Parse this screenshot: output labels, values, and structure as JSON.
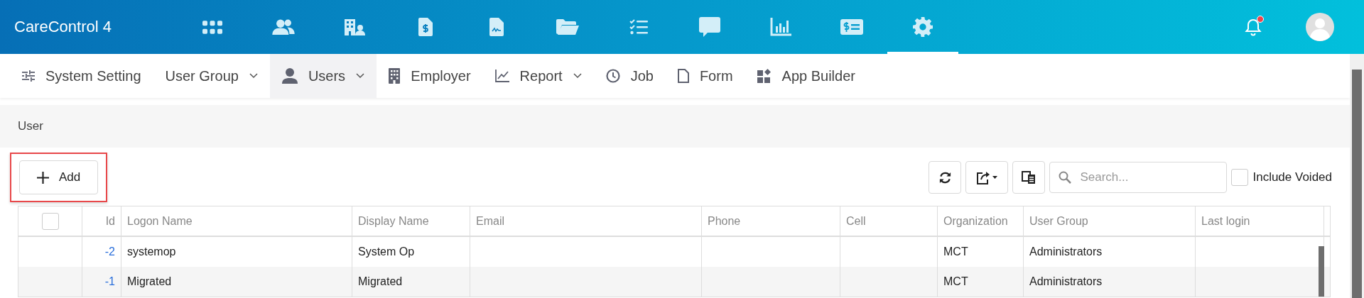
{
  "app": {
    "title": "CareControl 4"
  },
  "nav_icons": [
    {
      "selected": false
    },
    {
      "selected": false
    },
    {
      "selected": false
    },
    {
      "selected": false
    },
    {
      "selected": false
    },
    {
      "selected": false
    },
    {
      "selected": false
    },
    {
      "selected": false
    },
    {
      "selected": false
    },
    {
      "selected": false
    },
    {
      "selected": true
    }
  ],
  "notifications": {
    "unread": true
  },
  "menu": [
    {
      "label": "System Setting",
      "dropdown": false,
      "selected": false
    },
    {
      "label": "User Group",
      "dropdown": true,
      "selected": false
    },
    {
      "label": "Users",
      "dropdown": true,
      "selected": true
    },
    {
      "label": "Employer",
      "dropdown": false,
      "selected": false
    },
    {
      "label": "Report",
      "dropdown": true,
      "selected": false
    },
    {
      "label": "Job",
      "dropdown": false,
      "selected": false
    },
    {
      "label": "Form",
      "dropdown": false,
      "selected": false
    },
    {
      "label": "App Builder",
      "dropdown": false,
      "selected": false
    }
  ],
  "page": {
    "title": "User"
  },
  "toolbar": {
    "add_button": {
      "label": "Add",
      "highlighted": true
    },
    "search": {
      "placeholder": "Search..."
    },
    "include_voided": {
      "label": "Include Voided",
      "checked": false
    }
  },
  "table": {
    "select_all": {
      "checked": false
    },
    "columns": [
      "Id",
      "Logon Name",
      "Display Name",
      "Email",
      "Phone",
      "Cell",
      "Organization",
      "User Group",
      "Last login"
    ],
    "rows": [
      {
        "id": "-2",
        "logon_name": "systemop",
        "display_name": "System Op",
        "organization": "MCT",
        "user_group": "Administrators"
      },
      {
        "id": "-1",
        "logon_name": "Migrated",
        "display_name": "Migrated",
        "organization": "MCT",
        "user_group": "Administrators"
      }
    ]
  }
}
